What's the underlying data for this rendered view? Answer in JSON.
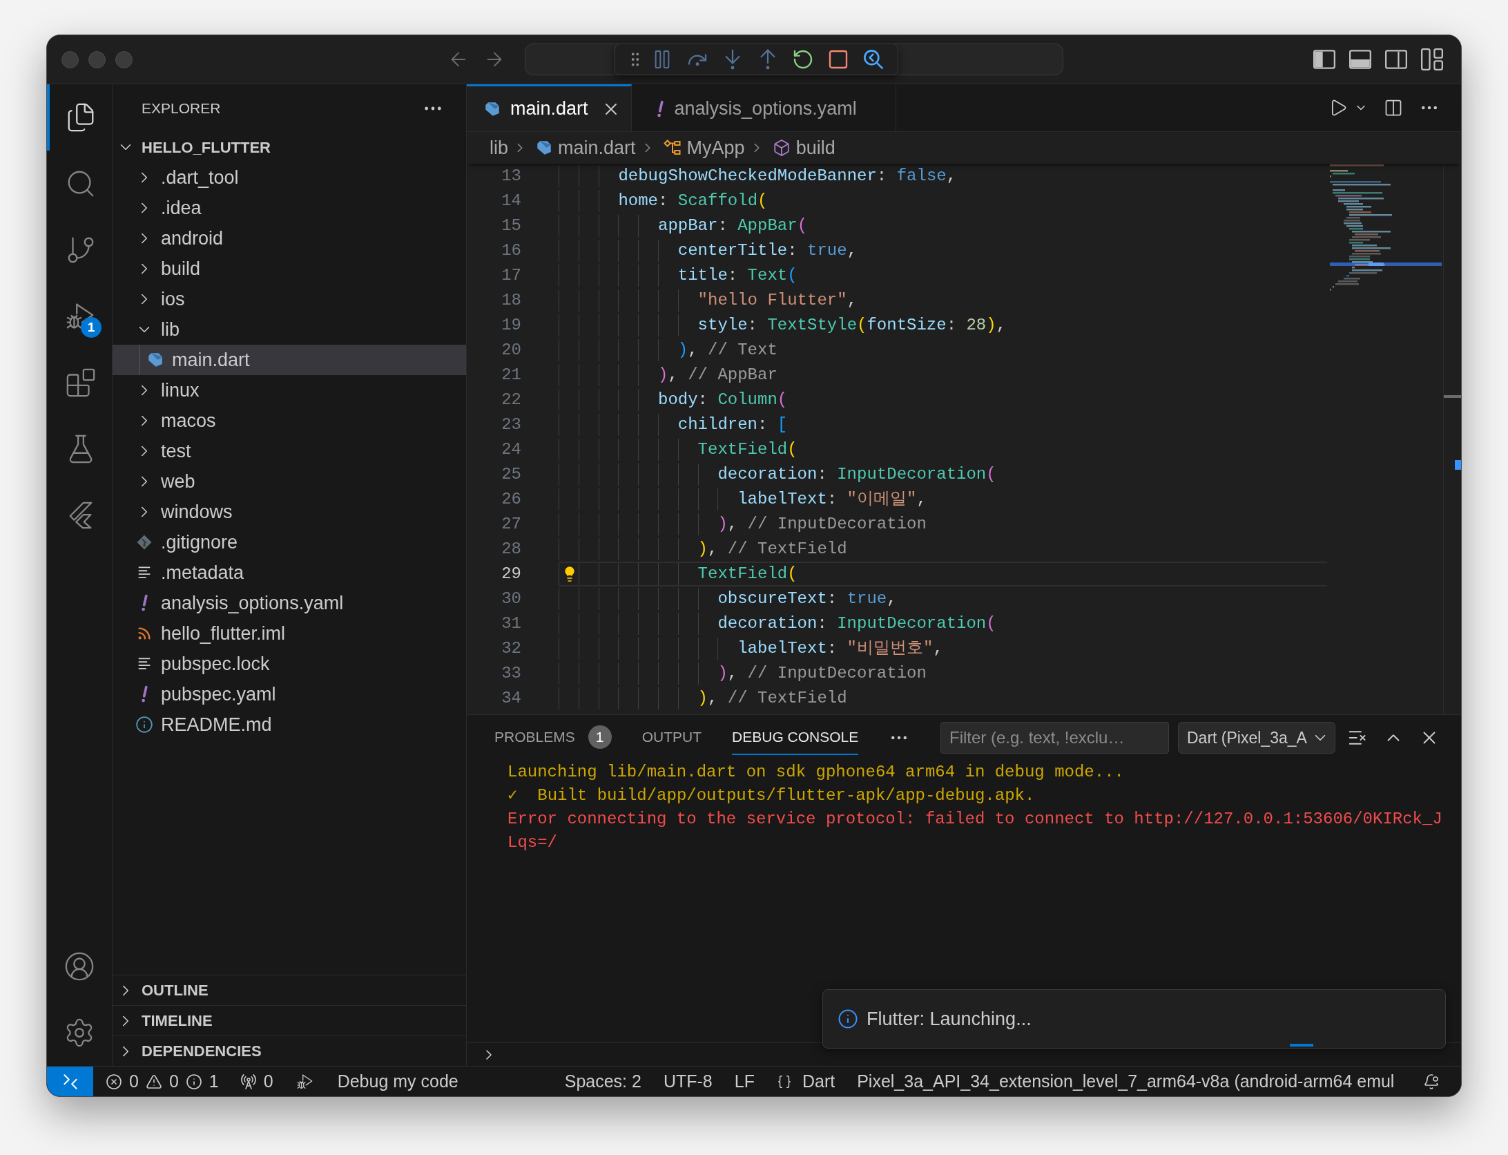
{
  "title_bar": {
    "layout_toggles": [
      {
        "kind": "primary-sidebar",
        "on": true
      },
      {
        "kind": "panel",
        "on": true
      },
      {
        "kind": "secondary-sidebar",
        "on": false
      }
    ]
  },
  "activity_bar": {
    "items": [
      {
        "kind": "explorer",
        "selected": true
      },
      {
        "kind": "search",
        "selected": false
      },
      {
        "kind": "source-control",
        "selected": false
      },
      {
        "kind": "run-debug",
        "selected": false,
        "badge": "1"
      },
      {
        "kind": "extensions",
        "selected": false
      },
      {
        "kind": "testing",
        "selected": false
      },
      {
        "kind": "flutter",
        "selected": false
      }
    ]
  },
  "sidebar": {
    "title": "EXPLORER",
    "root": {
      "label": "HELLO_FLUTTER",
      "expanded": true,
      "children": [
        {
          "label": ".dart_tool",
          "kind": "folder",
          "expanded": false,
          "selected": false
        },
        {
          "label": ".idea",
          "kind": "folder",
          "expanded": false,
          "selected": false
        },
        {
          "label": "android",
          "kind": "folder",
          "expanded": false,
          "selected": false
        },
        {
          "label": "build",
          "kind": "folder",
          "expanded": false,
          "selected": false
        },
        {
          "label": "ios",
          "kind": "folder",
          "expanded": false,
          "selected": false
        },
        {
          "label": "lib",
          "kind": "folder",
          "expanded": true,
          "selected": false,
          "children": [
            {
              "label": "main.dart",
              "kind": "dart",
              "selected": true
            }
          ]
        },
        {
          "label": "linux",
          "kind": "folder",
          "expanded": false,
          "selected": false
        },
        {
          "label": "macos",
          "kind": "folder",
          "expanded": false,
          "selected": false
        },
        {
          "label": "test",
          "kind": "folder",
          "expanded": false,
          "selected": false
        },
        {
          "label": "web",
          "kind": "folder",
          "expanded": false,
          "selected": false
        },
        {
          "label": "windows",
          "kind": "folder",
          "expanded": false,
          "selected": false
        },
        {
          "label": ".gitignore",
          "kind": "git",
          "selected": false
        },
        {
          "label": ".metadata",
          "kind": "text",
          "selected": false
        },
        {
          "label": "analysis_options.yaml",
          "kind": "yaml",
          "selected": false
        },
        {
          "label": "hello_flutter.iml",
          "kind": "iml",
          "selected": false
        },
        {
          "label": "pubspec.lock",
          "kind": "text",
          "selected": false
        },
        {
          "label": "pubspec.yaml",
          "kind": "yaml",
          "selected": false
        },
        {
          "label": "README.md",
          "kind": "markdown",
          "selected": false
        }
      ]
    },
    "sections": [
      {
        "label": "OUTLINE",
        "expanded": false
      },
      {
        "label": "TIMELINE",
        "expanded": false
      },
      {
        "label": "DEPENDENCIES",
        "expanded": false
      }
    ]
  },
  "editor": {
    "tabs": [
      {
        "label": "main.dart",
        "kind": "dart",
        "selected": true
      },
      {
        "label": "analysis_options.yaml",
        "kind": "yaml",
        "selected": false
      }
    ],
    "breadcrumbs": [
      {
        "label": "lib",
        "kind": "folder"
      },
      {
        "label": "main.dart",
        "kind": "dart"
      },
      {
        "label": "MyApp",
        "kind": "class"
      },
      {
        "label": "build",
        "kind": "method"
      }
    ],
    "lines": [
      {
        "number": "13",
        "current": false,
        "lightbulb": false,
        "tokens": [
          {
            "kind": "property",
            "text": "      debugShowCheckedModeBanner"
          },
          {
            "kind": "plain",
            "text": ": "
          },
          {
            "kind": "keyword",
            "text": "false"
          },
          {
            "kind": "plain",
            "text": ","
          }
        ]
      },
      {
        "number": "14",
        "current": false,
        "lightbulb": false,
        "tokens": [
          {
            "kind": "property",
            "text": "      home"
          },
          {
            "kind": "plain",
            "text": ": "
          },
          {
            "kind": "class",
            "text": "Scaffold"
          },
          {
            "kind": "bracket1",
            "text": "("
          }
        ]
      },
      {
        "number": "15",
        "current": false,
        "lightbulb": false,
        "tokens": [
          {
            "kind": "property",
            "text": "          appBar"
          },
          {
            "kind": "plain",
            "text": ": "
          },
          {
            "kind": "class",
            "text": "AppBar"
          },
          {
            "kind": "bracket2",
            "text": "("
          }
        ]
      },
      {
        "number": "16",
        "current": false,
        "lightbulb": false,
        "tokens": [
          {
            "kind": "property",
            "text": "            centerTitle"
          },
          {
            "kind": "plain",
            "text": ": "
          },
          {
            "kind": "keyword",
            "text": "true"
          },
          {
            "kind": "plain",
            "text": ","
          }
        ]
      },
      {
        "number": "17",
        "current": false,
        "lightbulb": false,
        "tokens": [
          {
            "kind": "property",
            "text": "            title"
          },
          {
            "kind": "plain",
            "text": ": "
          },
          {
            "kind": "class",
            "text": "Text"
          },
          {
            "kind": "bracket3",
            "text": "("
          }
        ]
      },
      {
        "number": "18",
        "current": false,
        "lightbulb": false,
        "tokens": [
          {
            "kind": "string",
            "text": "              \"hello Flutter\""
          },
          {
            "kind": "plain",
            "text": ","
          }
        ]
      },
      {
        "number": "19",
        "current": false,
        "lightbulb": false,
        "tokens": [
          {
            "kind": "property",
            "text": "              style"
          },
          {
            "kind": "plain",
            "text": ": "
          },
          {
            "kind": "class",
            "text": "TextStyle"
          },
          {
            "kind": "bracket1",
            "text": "("
          },
          {
            "kind": "property",
            "text": "fontSize"
          },
          {
            "kind": "plain",
            "text": ": "
          },
          {
            "kind": "number",
            "text": "28"
          },
          {
            "kind": "bracket1",
            "text": ")"
          },
          {
            "kind": "plain",
            "text": ","
          }
        ]
      },
      {
        "number": "20",
        "current": false,
        "lightbulb": false,
        "tokens": [
          {
            "kind": "bracket3",
            "text": "            )"
          },
          {
            "kind": "plain",
            "text": ", "
          },
          {
            "kind": "comment",
            "text": "// Text"
          }
        ]
      },
      {
        "number": "21",
        "current": false,
        "lightbulb": false,
        "tokens": [
          {
            "kind": "bracket2",
            "text": "          )"
          },
          {
            "kind": "plain",
            "text": ", "
          },
          {
            "kind": "comment",
            "text": "// AppBar"
          }
        ]
      },
      {
        "number": "22",
        "current": false,
        "lightbulb": false,
        "tokens": [
          {
            "kind": "property",
            "text": "          body"
          },
          {
            "kind": "plain",
            "text": ": "
          },
          {
            "kind": "class",
            "text": "Column"
          },
          {
            "kind": "bracket2",
            "text": "("
          }
        ]
      },
      {
        "number": "23",
        "current": false,
        "lightbulb": false,
        "tokens": [
          {
            "kind": "property",
            "text": "            children"
          },
          {
            "kind": "plain",
            "text": ": "
          },
          {
            "kind": "bracket3",
            "text": "["
          }
        ]
      },
      {
        "number": "24",
        "current": false,
        "lightbulb": false,
        "tokens": [
          {
            "kind": "class",
            "text": "              TextField"
          },
          {
            "kind": "bracket1",
            "text": "("
          }
        ]
      },
      {
        "number": "25",
        "current": false,
        "lightbulb": false,
        "tokens": [
          {
            "kind": "property",
            "text": "                decoration"
          },
          {
            "kind": "plain",
            "text": ": "
          },
          {
            "kind": "class",
            "text": "InputDecoration"
          },
          {
            "kind": "bracket2",
            "text": "("
          }
        ]
      },
      {
        "number": "26",
        "current": false,
        "lightbulb": false,
        "tokens": [
          {
            "kind": "property",
            "text": "                  labelText"
          },
          {
            "kind": "plain",
            "text": ": "
          },
          {
            "kind": "string",
            "text": "\"이메일\""
          },
          {
            "kind": "plain",
            "text": ","
          }
        ]
      },
      {
        "number": "27",
        "current": false,
        "lightbulb": false,
        "tokens": [
          {
            "kind": "bracket2",
            "text": "                )"
          },
          {
            "kind": "plain",
            "text": ", "
          },
          {
            "kind": "comment",
            "text": "// InputDecoration"
          }
        ]
      },
      {
        "number": "28",
        "current": false,
        "lightbulb": false,
        "tokens": [
          {
            "kind": "bracket1",
            "text": "              )"
          },
          {
            "kind": "plain",
            "text": ", "
          },
          {
            "kind": "comment",
            "text": "// TextField"
          }
        ]
      },
      {
        "number": "29",
        "current": true,
        "lightbulb": true,
        "tokens": [
          {
            "kind": "class",
            "text": "              TextField"
          },
          {
            "kind": "bracket1",
            "text": "("
          }
        ]
      },
      {
        "number": "30",
        "current": false,
        "lightbulb": false,
        "tokens": [
          {
            "kind": "property",
            "text": "                obscureText"
          },
          {
            "kind": "plain",
            "text": ": "
          },
          {
            "kind": "keyword",
            "text": "true"
          },
          {
            "kind": "plain",
            "text": ","
          }
        ]
      },
      {
        "number": "31",
        "current": false,
        "lightbulb": false,
        "tokens": [
          {
            "kind": "property",
            "text": "                decoration"
          },
          {
            "kind": "plain",
            "text": ": "
          },
          {
            "kind": "class",
            "text": "InputDecoration"
          },
          {
            "kind": "bracket2",
            "text": "("
          }
        ]
      },
      {
        "number": "32",
        "current": false,
        "lightbulb": false,
        "tokens": [
          {
            "kind": "property",
            "text": "                  labelText"
          },
          {
            "kind": "plain",
            "text": ": "
          },
          {
            "kind": "string",
            "text": "\"비밀번호\""
          },
          {
            "kind": "plain",
            "text": ","
          }
        ]
      },
      {
        "number": "33",
        "current": false,
        "lightbulb": false,
        "tokens": [
          {
            "kind": "bracket2",
            "text": "                )"
          },
          {
            "kind": "plain",
            "text": ", "
          },
          {
            "kind": "comment",
            "text": "// InputDecoration"
          }
        ]
      },
      {
        "number": "34",
        "current": false,
        "lightbulb": false,
        "tokens": [
          {
            "kind": "bracket1",
            "text": "              )"
          },
          {
            "kind": "plain",
            "text": ", "
          },
          {
            "kind": "comment",
            "text": "// TextField"
          }
        ]
      }
    ]
  },
  "panel": {
    "tabs": [
      {
        "label": "PROBLEMS",
        "badge": "1",
        "selected": false
      },
      {
        "label": "OUTPUT",
        "selected": false
      },
      {
        "label": "DEBUG CONSOLE",
        "selected": true
      }
    ],
    "filter": {
      "placeholder": "Filter (e.g. text, !exclu…"
    },
    "session": "Dart (Pixel_3a_A",
    "console": [
      {
        "kind": "info",
        "text": "Launching lib/main.dart on sdk gphone64 arm64 in debug mode..."
      },
      {
        "kind": "info",
        "text": "✓  Built build/app/outputs/flutter-apk/app-debug.apk."
      },
      {
        "kind": "error",
        "text": "Error connecting to the service protocol: failed to connect to http://127.0.0.1:53606/0KIRck_JLqs=/"
      }
    ]
  },
  "notification": {
    "message": "Flutter: Launching..."
  },
  "status_bar": {
    "problems": [
      {
        "kind": "error",
        "count": "0"
      },
      {
        "kind": "warning",
        "count": "0"
      },
      {
        "kind": "info",
        "count": "1"
      }
    ],
    "ports": "0",
    "launch": "Debug my code",
    "items": [
      {
        "kind": "text",
        "label": "Spaces: 2"
      },
      {
        "kind": "text",
        "label": "UTF-8"
      },
      {
        "kind": "text",
        "label": "LF"
      },
      {
        "kind": "language",
        "label": "Dart"
      },
      {
        "kind": "text",
        "label": "Pixel_3a_API_34_extension_level_7_arm64-v8a (android-arm64 emul"
      }
    ]
  }
}
